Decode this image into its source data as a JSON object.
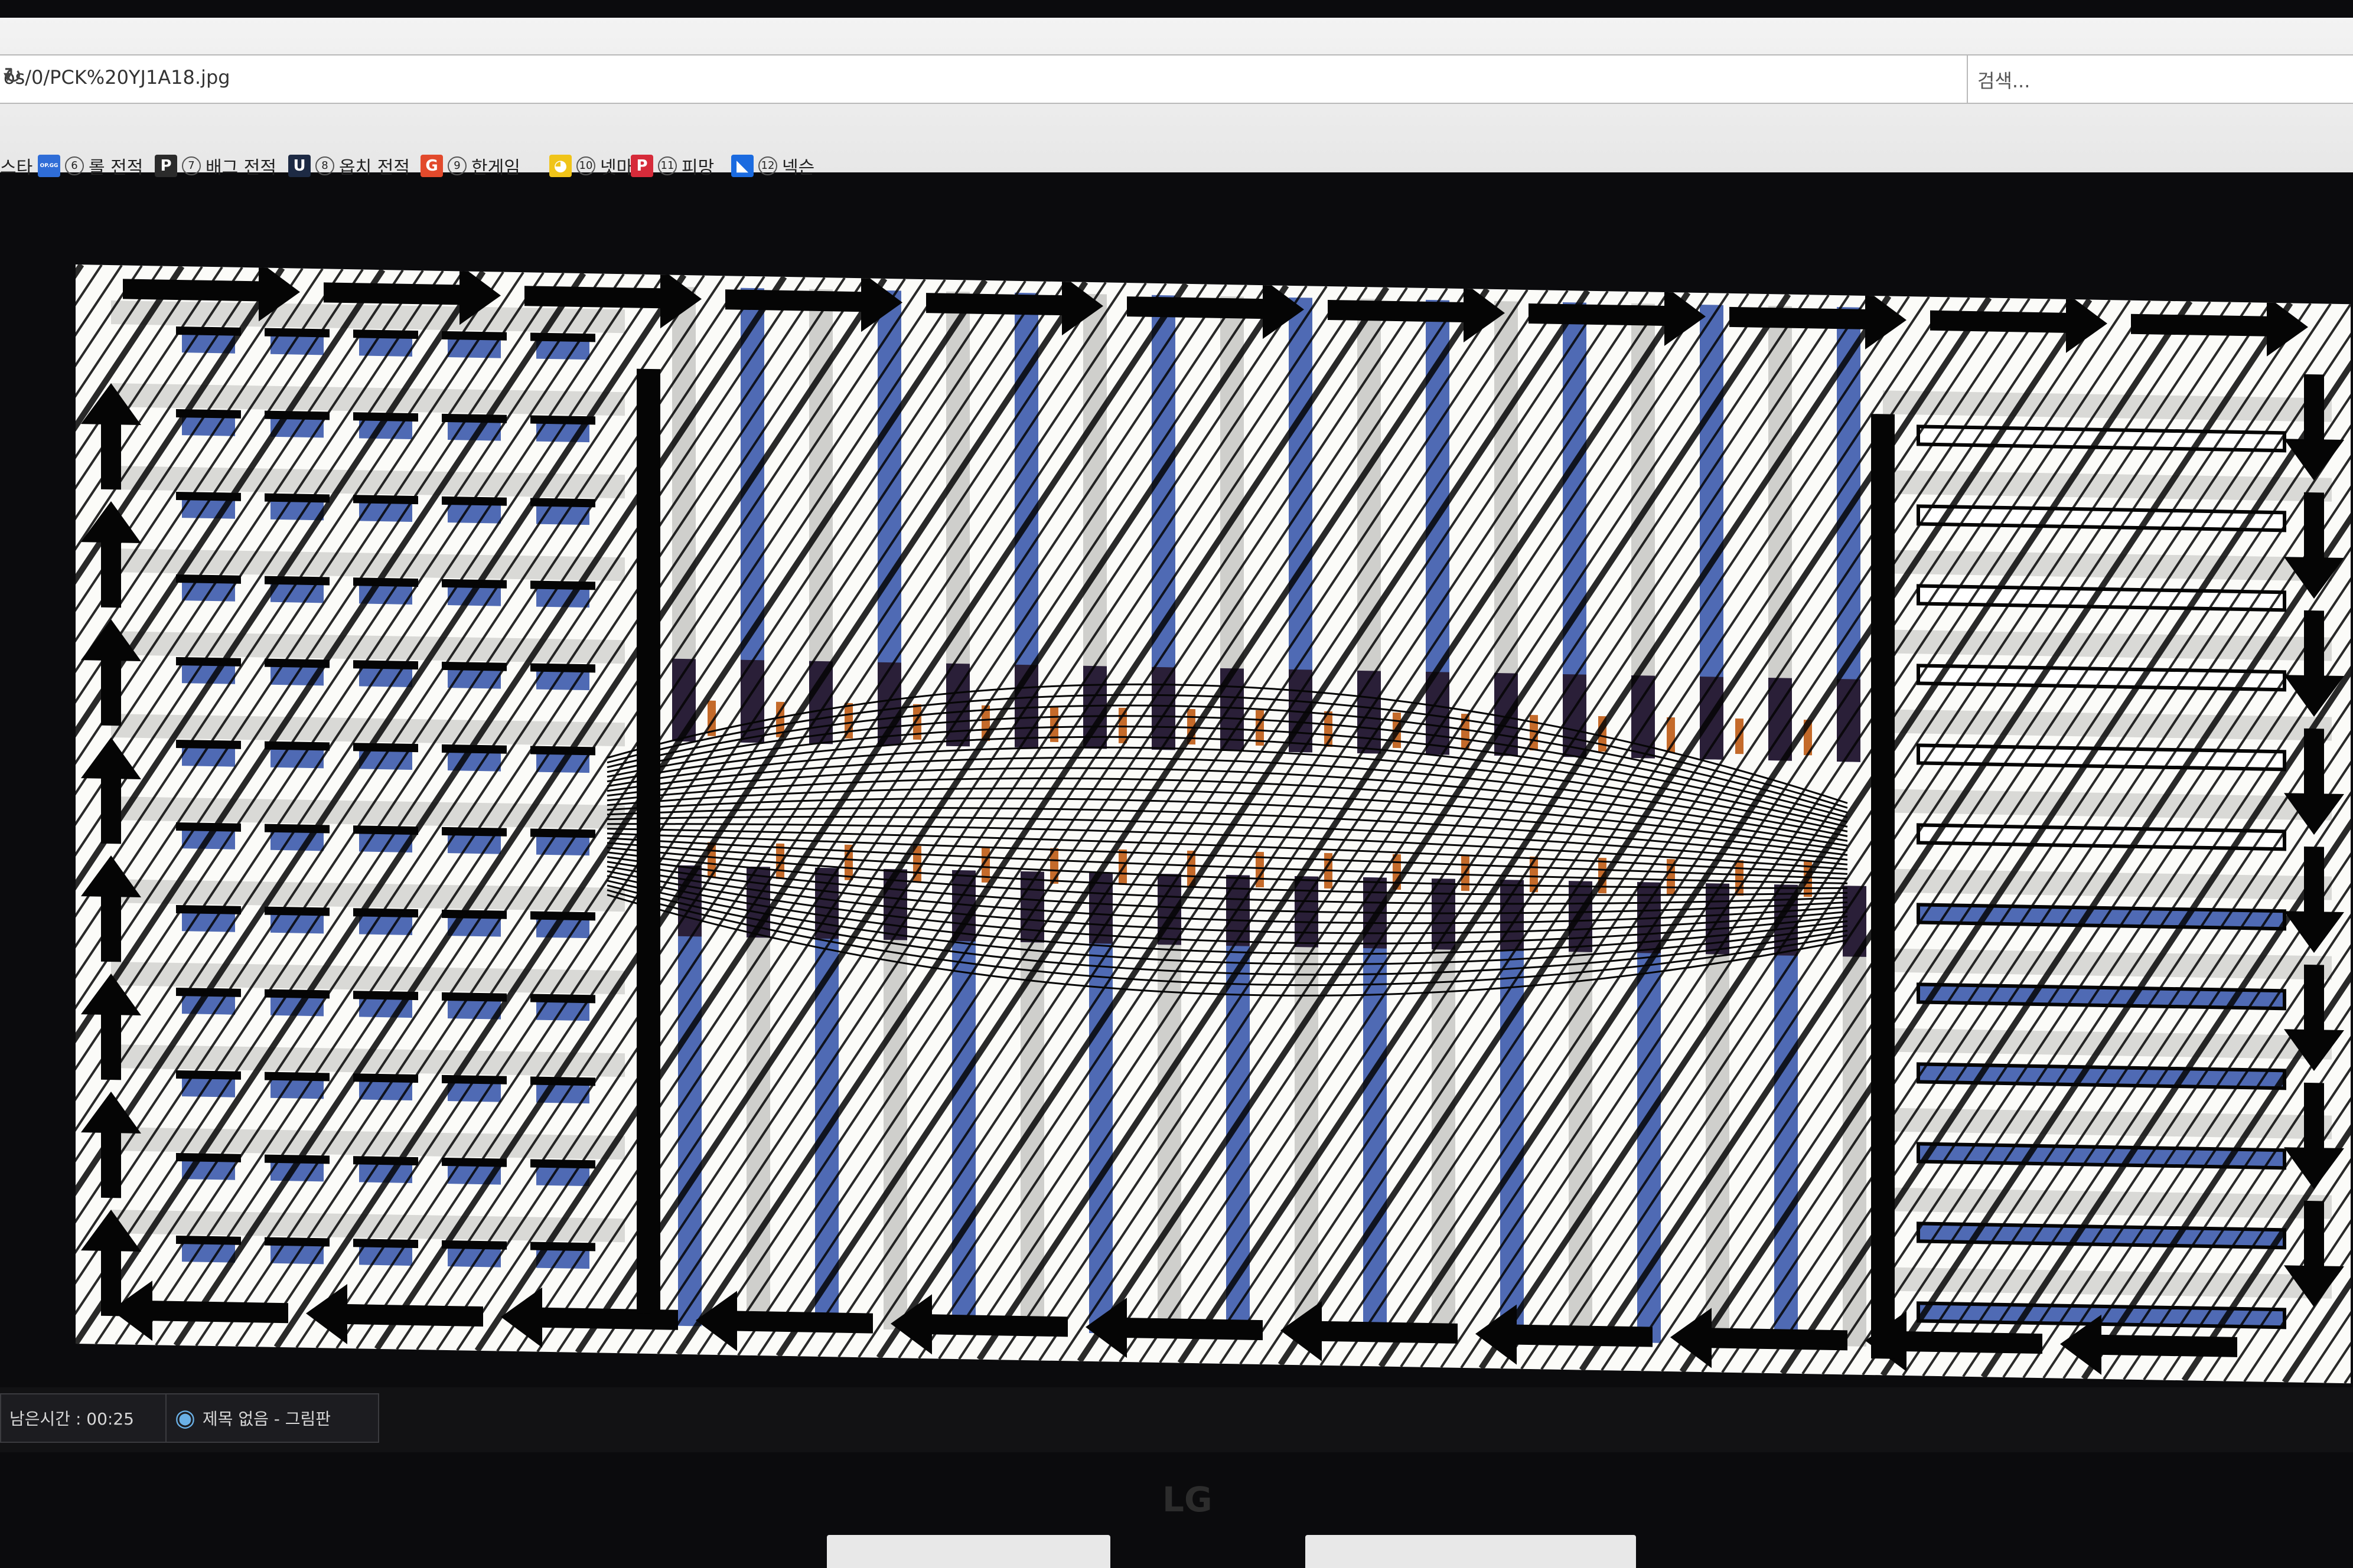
{
  "browser": {
    "address_value": "os/0/PCK%20YJ1A18.jpg",
    "search_placeholder": "검색..."
  },
  "bookmarks": [
    {
      "icon": "op-gg-icon",
      "icon_text": "OP.GG",
      "color": "#2f6dd7",
      "num": "⑥",
      "label": "롤 전적"
    },
    {
      "icon": "pubg-icon",
      "icon_text": "P",
      "color": "#2b2b2b",
      "num": "⑦",
      "label": "배그 전적"
    },
    {
      "icon": "overwatch-icon",
      "icon_text": "U",
      "color": "#1d2a44",
      "num": "⑧",
      "label": "옵치 전적"
    },
    {
      "icon": "hangame-icon",
      "icon_text": "G",
      "color": "#e24a2c",
      "num": "⑨",
      "label": "한게임"
    },
    {
      "icon": "netmarble-icon",
      "icon_text": "◕",
      "color": "#f0c419",
      "num": "⑩",
      "label": "넷마블"
    },
    {
      "icon": "pmang-icon",
      "icon_text": "P",
      "color": "#d62b3a",
      "num": "⑪",
      "label": "피망"
    },
    {
      "icon": "nexon-icon",
      "icon_text": "◣",
      "color": "#1b6be0",
      "num": "⑫",
      "label": "넥슨"
    }
  ],
  "bookmark_prefix": "스타",
  "taskbar": {
    "timer_label": "남은시간 : 00:25",
    "paint_window_label": "제목 없음 - 그림판"
  },
  "monitor_brand": "LG",
  "colors": {
    "blue_stripe": "#4f6ab4",
    "dark_cap": "#2a1f38",
    "orange_part": "#c46a2a",
    "ink": "#050505"
  }
}
